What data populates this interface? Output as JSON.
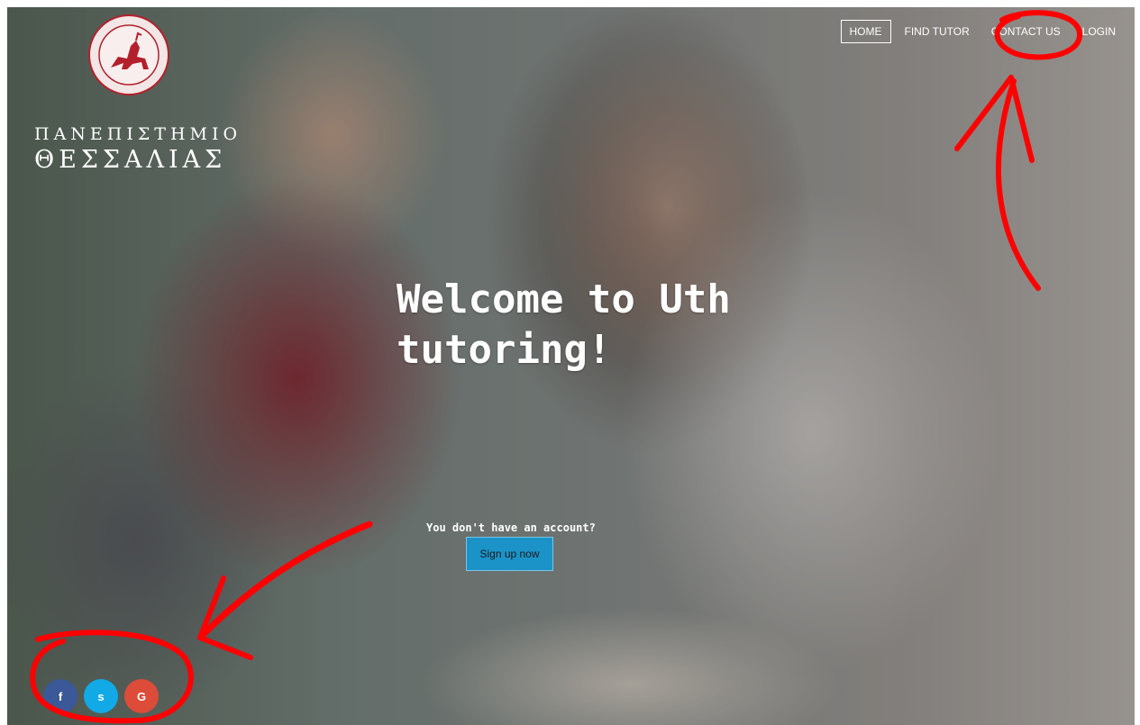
{
  "logo": {
    "line1": "ΠΑΝΕΠΙΣΤΗΜΙΟ",
    "line2": "ΘΕΣΣΑΛΙΑΣ"
  },
  "nav": {
    "home": "HOME",
    "find_tutor": "FIND TUTOR",
    "contact_us": "CONTACT US",
    "login": "LOGIN"
  },
  "hero": {
    "headline_line1": "Welcome to Uth",
    "headline_line2": "tutoring!",
    "no_account": "You don't have an account?",
    "signup_label": "Sign up now"
  },
  "social": {
    "facebook_glyph": "f",
    "skype_glyph": "s",
    "google_glyph": "G"
  },
  "colors": {
    "signup_bg": "#1b93c9",
    "facebook": "#3b5998",
    "skype": "#11a9e6",
    "google": "#dd4b39",
    "annotation": "#ff0000"
  }
}
